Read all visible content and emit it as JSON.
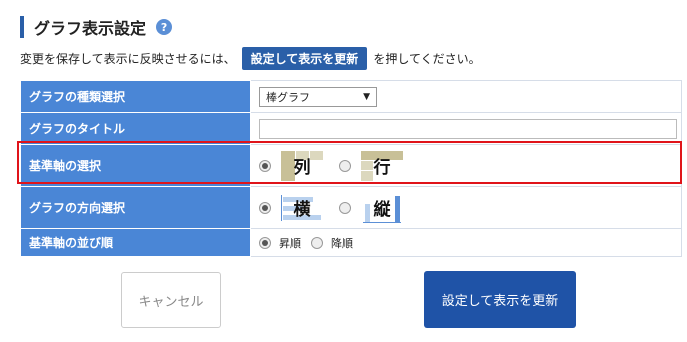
{
  "header": {
    "title": "グラフ表示設定",
    "help_icon": "?"
  },
  "instruction": {
    "before": "変更を保存して表示に反映させるには、",
    "button": "設定して表示を更新",
    "after": "を押してください。"
  },
  "rows": {
    "graph_type": {
      "label": "グラフの種類選択",
      "selected": "棒グラフ"
    },
    "graph_title": {
      "label": "グラフのタイトル",
      "value": ""
    },
    "base_axis": {
      "label": "基準軸の選択",
      "options": [
        "列",
        "行"
      ],
      "selected_index": 0
    },
    "direction": {
      "label": "グラフの方向選択",
      "options": [
        "横",
        "縦"
      ],
      "selected_index": 0
    },
    "axis_order": {
      "label": "基準軸の並び順",
      "options": [
        "昇順",
        "降順"
      ],
      "selected_index": 0
    }
  },
  "buttons": {
    "cancel": "キャンセル",
    "update": "設定して表示を更新"
  },
  "colors": {
    "label_bg": "#4a86d6",
    "primary": "#1f53a7",
    "highlight": "#e0141a"
  }
}
